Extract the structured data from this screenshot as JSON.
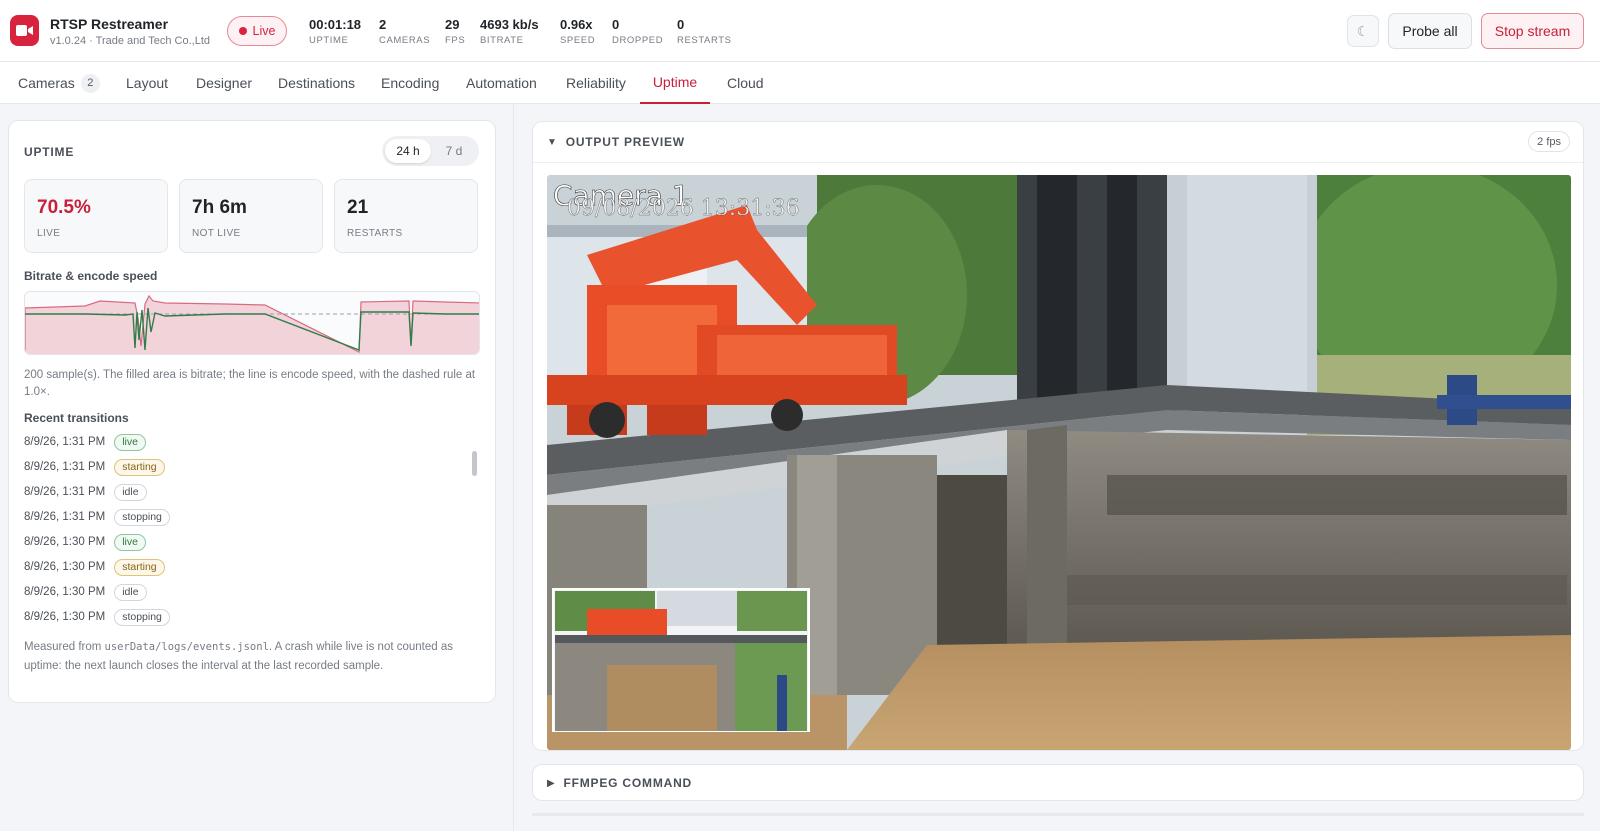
{
  "app": {
    "name": "RTSP Restreamer",
    "subtitle": "v1.0.24 · Trade and Tech Co.,Ltd",
    "status": "Live"
  },
  "stats": [
    {
      "value": "00:01:18",
      "label": "UPTIME"
    },
    {
      "value": "2",
      "label": "CAMERAS"
    },
    {
      "value": "29",
      "label": "FPS"
    },
    {
      "value": "4693 kb/s",
      "label": "BITRATE"
    },
    {
      "value": "0.96x",
      "label": "SPEED"
    },
    {
      "value": "0",
      "label": "DROPPED"
    },
    {
      "value": "0",
      "label": "RESTARTS"
    }
  ],
  "header_buttons": {
    "theme_icon": "moon-icon",
    "probe": "Probe all",
    "stop": "Stop stream"
  },
  "tabs": [
    {
      "label": "Cameras",
      "badge": "2"
    },
    {
      "label": "Layout"
    },
    {
      "label": "Designer"
    },
    {
      "label": "Destinations"
    },
    {
      "label": "Encoding"
    },
    {
      "label": "Automation"
    },
    {
      "label": "Reliability"
    },
    {
      "label": "Uptime",
      "active": true
    },
    {
      "label": "Cloud"
    }
  ],
  "uptime": {
    "title": "UPTIME",
    "range_options": [
      "24 h",
      "7 d"
    ],
    "range_selected": "24 h",
    "tiles": [
      {
        "value": "70.5%",
        "label": "LIVE"
      },
      {
        "value": "7h 6m",
        "label": "NOT LIVE"
      },
      {
        "value": "21",
        "label": "RESTARTS"
      }
    ],
    "chart_label": "Bitrate & encode speed",
    "chart_note": "200 sample(s). The filled area is bitrate; the line is encode speed, with the dashed rule at 1.0×.",
    "transitions_label": "Recent transitions",
    "transitions": [
      {
        "time": "8/9/26, 1:31 PM",
        "state": "live"
      },
      {
        "time": "8/9/26, 1:31 PM",
        "state": "starting"
      },
      {
        "time": "8/9/26, 1:31 PM",
        "state": "idle"
      },
      {
        "time": "8/9/26, 1:31 PM",
        "state": "stopping"
      },
      {
        "time": "8/9/26, 1:30 PM",
        "state": "live"
      },
      {
        "time": "8/9/26, 1:30 PM",
        "state": "starting"
      },
      {
        "time": "8/9/26, 1:30 PM",
        "state": "idle"
      },
      {
        "time": "8/9/26, 1:30 PM",
        "state": "stopping"
      }
    ],
    "footnote_pre": "Measured from ",
    "footnote_code": "userData/logs/events.jsonl",
    "footnote_post": ". A crash while live is not counted as uptime: the next launch closes the interval at the last recorded sample."
  },
  "preview": {
    "title": "OUTPUT PREVIEW",
    "fps_badge": "2 fps",
    "overlay_camera": "Camera 1",
    "overlay_timestamp": "09/08/2026 13:31:36"
  },
  "ffmpeg": {
    "title": "FFMPEG COMMAND"
  },
  "colors": {
    "accent": "#c8203a",
    "live_green": "#2c7a3e",
    "starting_amber": "#8a6416",
    "chart_fill": "#f3d3da",
    "speed_line": "#2f7d4a"
  }
}
